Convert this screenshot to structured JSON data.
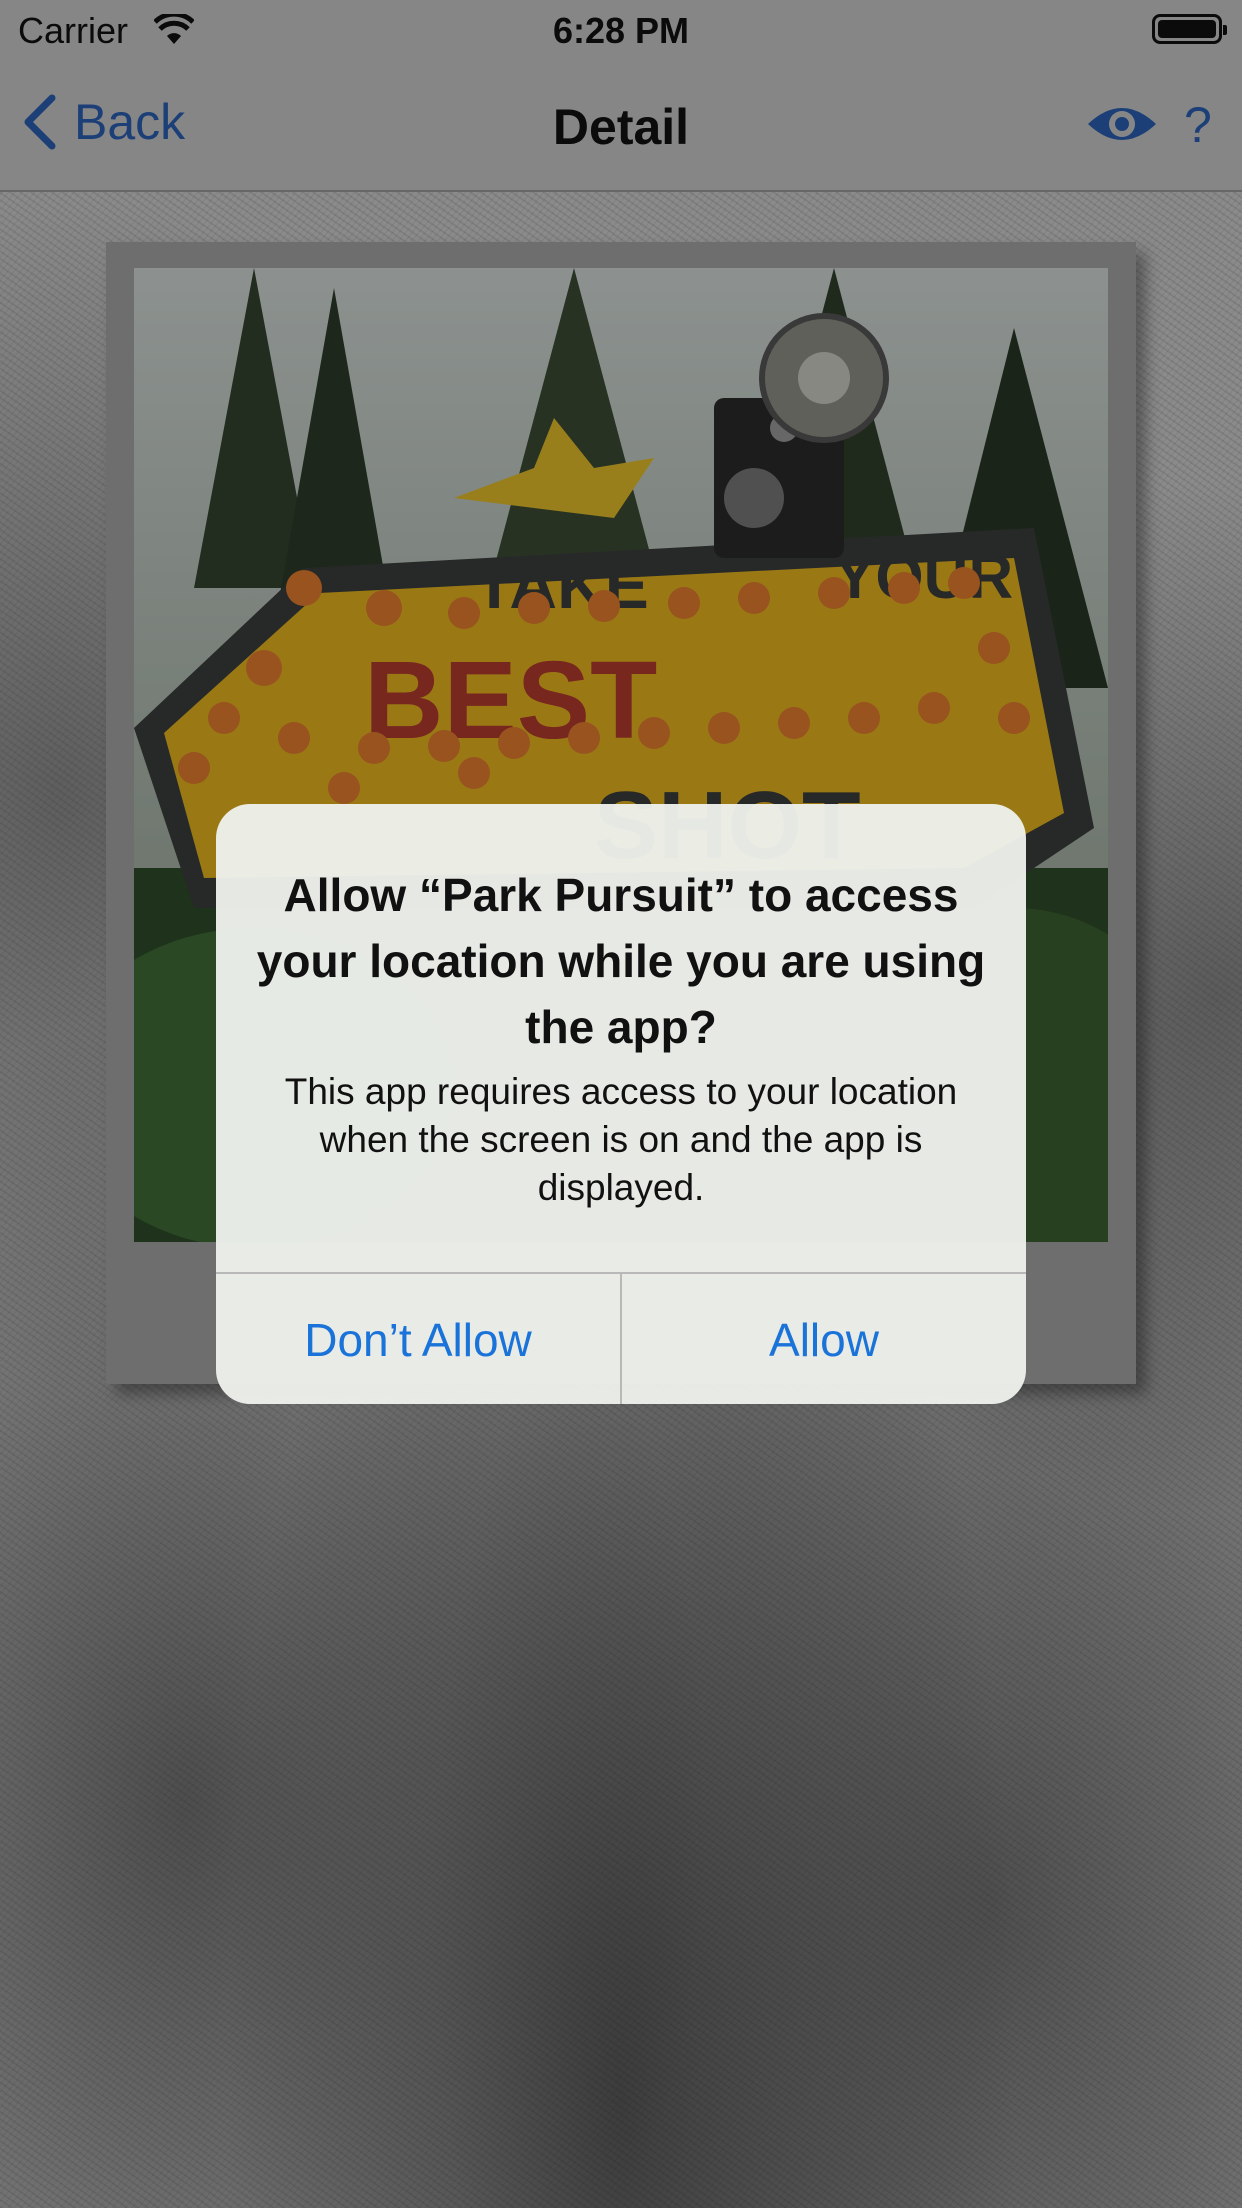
{
  "status_bar": {
    "carrier": "Carrier",
    "time": "6:28 PM"
  },
  "nav": {
    "back_label": "Back",
    "title": "Detail",
    "help_label": "?"
  },
  "photo": {
    "sign_text": [
      "TAKE",
      "YOUR",
      "BEST",
      "SHOT"
    ]
  },
  "alert": {
    "title": "Allow “Park Pursuit” to access your location while you are using the app?",
    "message": "This app requires access to your location when the screen is on and the app is displayed.",
    "deny_label": "Don’t Allow",
    "allow_label": "Allow"
  },
  "colors": {
    "accent": "#2a5db0",
    "alert_button": "#1a73d9",
    "sign_yellow": "#e3b31f",
    "sign_red": "#b23a2e"
  },
  "icons": [
    "wifi-icon",
    "battery-icon",
    "back-chevron-icon",
    "eye-icon"
  ]
}
